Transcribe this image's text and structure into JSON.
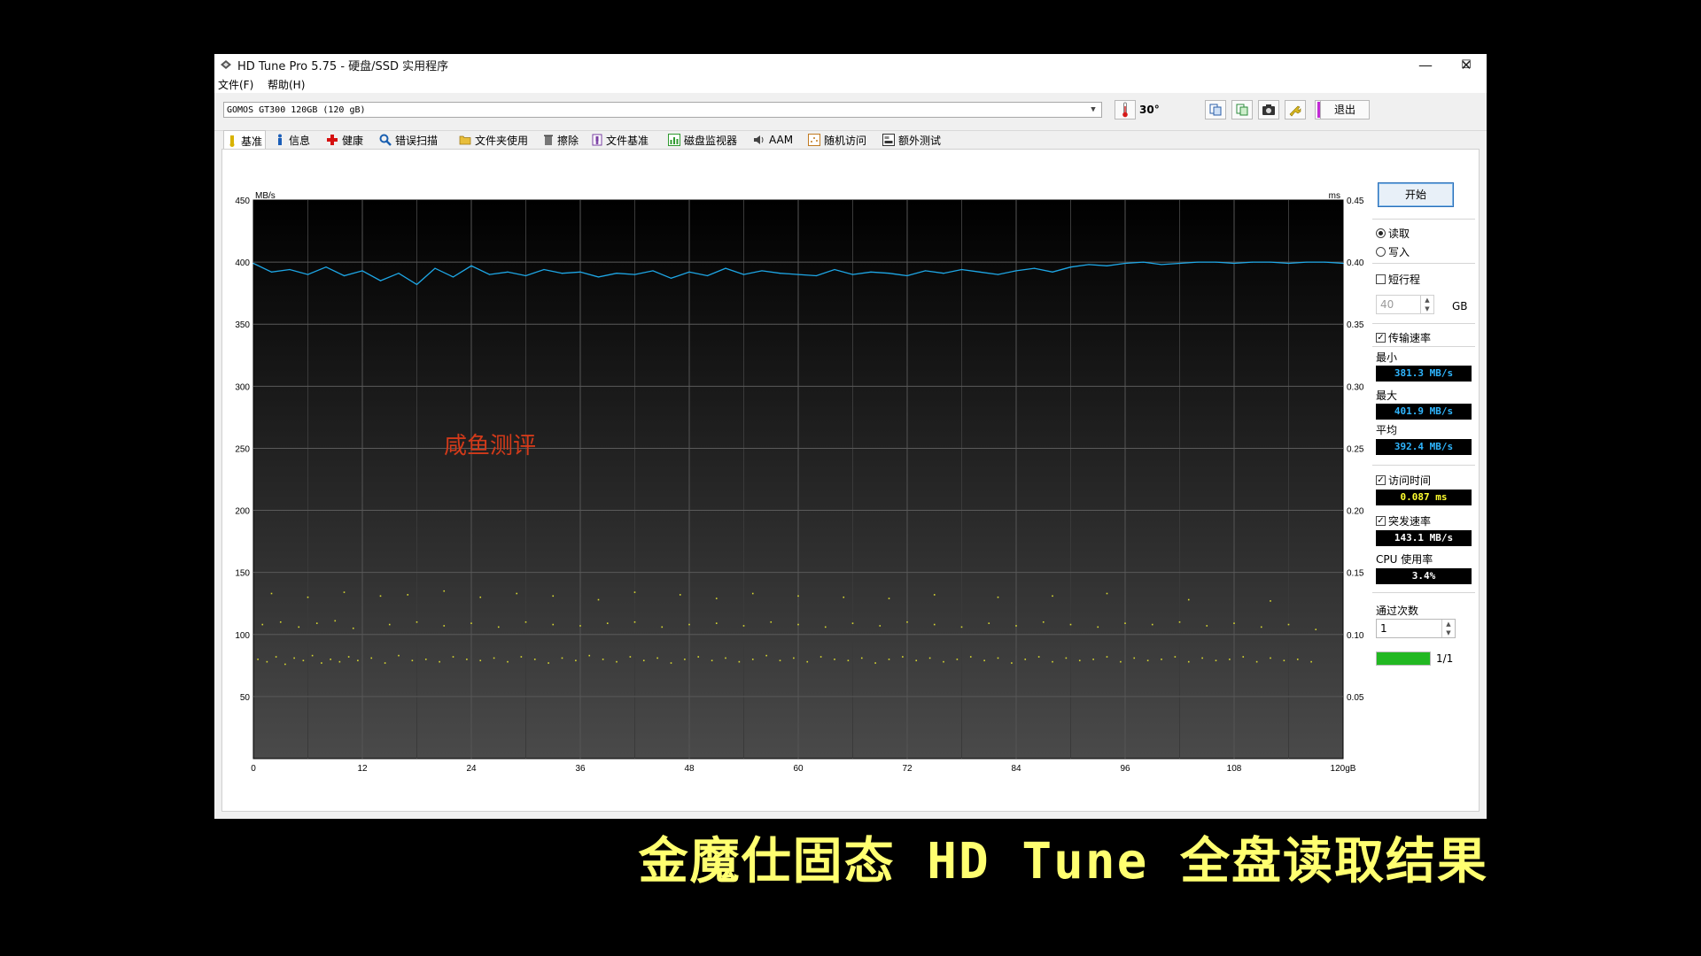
{
  "window": {
    "title": "HD Tune Pro 5.75 - 硬盘/SSD 实用程序",
    "minimize": "—",
    "maximize": "☐",
    "close": "✕"
  },
  "menu": {
    "file": "文件(F)",
    "help": "帮助(H)"
  },
  "toolbar": {
    "drive": "GOMOS GT300 120GB (120 gB)",
    "temperature": "30°",
    "exit_label": "退出"
  },
  "tabs": [
    {
      "label": "基准",
      "icon": "benchmark-icon",
      "color": "#c9a400"
    },
    {
      "label": "信息",
      "icon": "info-icon",
      "color": "#1b5eb8"
    },
    {
      "label": "健康",
      "icon": "health-icon",
      "color": "#d51010"
    },
    {
      "label": "错误扫描",
      "icon": "error-scan-icon",
      "color": "#1a5fb0"
    },
    {
      "label": "文件夹使用",
      "icon": "folder-icon",
      "color": "#d6a623"
    },
    {
      "label": "擦除",
      "icon": "erase-icon",
      "color": "#555555"
    },
    {
      "label": "文件基准",
      "icon": "file-benchmark-icon",
      "color": "#7a3fa3"
    },
    {
      "label": "磁盘监视器",
      "icon": "disk-monitor-icon",
      "color": "#2f9a2f"
    },
    {
      "label": "AAM",
      "icon": "speaker-icon",
      "color": "#444444"
    },
    {
      "label": "随机访问",
      "icon": "random-access-icon",
      "color": "#c07a20"
    },
    {
      "label": "额外测试",
      "icon": "extra-test-icon",
      "color": "#333333"
    }
  ],
  "side": {
    "start_label": "开始",
    "read_label": "读取",
    "write_label": "写入",
    "short_stroke_label": "短行程",
    "short_stroke_value": "40",
    "gb_label": "GB",
    "transfer_rate_label": "传输速率",
    "min_label": "最小",
    "min_value": "381.3 MB/s",
    "max_label": "最大",
    "max_value": "401.9 MB/s",
    "avg_label": "平均",
    "avg_value": "392.4 MB/s",
    "access_time_label": "访问时间",
    "access_time_value": "0.087 ms",
    "burst_rate_label": "突发速率",
    "burst_rate_value": "143.1 MB/s",
    "cpu_label": "CPU 使用率",
    "cpu_value": "3.4%",
    "passes_label": "通过次数",
    "passes_value": "1",
    "progress_text": "1/1",
    "progress": 1.0,
    "colors": {
      "speed": "#00b4ff",
      "access": "#ffff30",
      "progress": "#22b822"
    }
  },
  "watermark": "咸鱼测评",
  "caption": "金魔仕固态 HD Tune 全盘读取结果",
  "chart_data": {
    "type": "line",
    "title": "",
    "y_left_unit": "MB/s",
    "y_right_unit": "ms",
    "x_unit": "gB",
    "xlim": [
      0,
      120
    ],
    "ylim": [
      0,
      450
    ],
    "y2lim": [
      0,
      0.45
    ],
    "grid": true,
    "x_ticks": [
      "0",
      "12",
      "24",
      "36",
      "48",
      "60",
      "72",
      "84",
      "96",
      "108",
      "120gB"
    ],
    "y_ticks": [
      "450",
      "400",
      "350",
      "300",
      "250",
      "200",
      "150",
      "100",
      "50"
    ],
    "y2_ticks": [
      "0.45",
      "0.40",
      "0.35",
      "0.30",
      "0.25",
      "0.20",
      "0.15",
      "0.10",
      "0.05"
    ],
    "series": [
      {
        "metric": "transfer rate (MB/s)",
        "color": "#1ea7e6",
        "x": [
          0,
          2,
          4,
          6,
          8,
          10,
          12,
          14,
          16,
          18,
          20,
          22,
          24,
          26,
          28,
          30,
          32,
          34,
          36,
          38,
          40,
          42,
          44,
          46,
          48,
          50,
          52,
          54,
          56,
          58,
          60,
          62,
          64,
          66,
          68,
          70,
          72,
          74,
          76,
          78,
          80,
          82,
          84,
          86,
          88,
          90,
          92,
          94,
          96,
          98,
          100,
          102,
          104,
          106,
          108,
          110,
          112,
          114,
          116,
          118,
          120
        ],
        "values": [
          399,
          392,
          394,
          390,
          396,
          389,
          393,
          385,
          391,
          382,
          395,
          388,
          397,
          390,
          392,
          389,
          394,
          391,
          392,
          388,
          391,
          390,
          393,
          387,
          392,
          389,
          395,
          390,
          393,
          391,
          390,
          389,
          394,
          390,
          392,
          391,
          389,
          393,
          391,
          394,
          392,
          390,
          393,
          395,
          392,
          396,
          398,
          397,
          399,
          400,
          398,
          399,
          400,
          400,
          399,
          400,
          400,
          399,
          400,
          400,
          399
        ]
      },
      {
        "metric": "access time (ms)",
        "color": "#d8d830",
        "type": "scatter",
        "x": [
          0.5,
          1.5,
          2.5,
          3.5,
          4.5,
          5.5,
          6.5,
          7.5,
          8.5,
          9.5,
          10.5,
          11.5,
          13,
          14.5,
          16,
          17.5,
          19,
          20.5,
          22,
          23.5,
          25,
          26.5,
          28,
          29.5,
          31,
          32.5,
          34,
          35.5,
          37,
          38.5,
          40,
          41.5,
          43,
          44.5,
          46,
          47.5,
          49,
          50.5,
          52,
          53.5,
          55,
          56.5,
          58,
          59.5,
          61,
          62.5,
          64,
          65.5,
          67,
          68.5,
          70,
          71.5,
          73,
          74.5,
          76,
          77.5,
          79,
          80.5,
          82,
          83.5,
          85,
          86.5,
          88,
          89.5,
          91,
          92.5,
          94,
          95.5,
          97,
          98.5,
          100,
          101.5,
          103,
          104.5,
          106,
          107.5,
          109,
          110.5,
          112,
          113.5,
          115,
          116.5,
          1,
          3,
          5,
          7,
          9,
          11,
          15,
          18,
          21,
          24,
          27,
          30,
          33,
          36,
          39,
          42,
          45,
          48,
          51,
          54,
          57,
          60,
          63,
          66,
          69,
          72,
          75,
          78,
          81,
          84,
          87,
          90,
          93,
          96,
          99,
          102,
          105,
          108,
          111,
          114,
          117,
          2,
          6,
          10,
          14,
          17,
          21,
          25,
          29,
          33,
          38,
          42,
          47,
          51,
          55,
          60,
          65,
          70,
          75,
          82,
          88,
          94,
          103,
          112
        ],
        "values": [
          0.08,
          0.078,
          0.082,
          0.076,
          0.081,
          0.079,
          0.083,
          0.077,
          0.08,
          0.078,
          0.082,
          0.079,
          0.081,
          0.077,
          0.083,
          0.079,
          0.08,
          0.078,
          0.082,
          0.08,
          0.079,
          0.081,
          0.078,
          0.082,
          0.08,
          0.077,
          0.081,
          0.079,
          0.083,
          0.08,
          0.078,
          0.082,
          0.079,
          0.081,
          0.077,
          0.08,
          0.082,
          0.079,
          0.081,
          0.078,
          0.08,
          0.083,
          0.079,
          0.081,
          0.078,
          0.082,
          0.08,
          0.079,
          0.081,
          0.077,
          0.08,
          0.082,
          0.079,
          0.081,
          0.078,
          0.08,
          0.082,
          0.079,
          0.081,
          0.077,
          0.08,
          0.082,
          0.078,
          0.081,
          0.079,
          0.08,
          0.082,
          0.078,
          0.081,
          0.079,
          0.08,
          0.082,
          0.078,
          0.081,
          0.079,
          0.08,
          0.082,
          0.078,
          0.081,
          0.079,
          0.08,
          0.078,
          0.108,
          0.11,
          0.106,
          0.109,
          0.111,
          0.105,
          0.108,
          0.11,
          0.107,
          0.109,
          0.106,
          0.11,
          0.108,
          0.107,
          0.109,
          0.11,
          0.106,
          0.108,
          0.109,
          0.107,
          0.11,
          0.108,
          0.106,
          0.109,
          0.107,
          0.11,
          0.108,
          0.106,
          0.109,
          0.107,
          0.11,
          0.108,
          0.106,
          0.109,
          0.108,
          0.11,
          0.107,
          0.109,
          0.106,
          0.108,
          0.104,
          0.133,
          0.13,
          0.134,
          0.131,
          0.132,
          0.135,
          0.13,
          0.133,
          0.131,
          0.128,
          0.134,
          0.132,
          0.129,
          0.133,
          0.131,
          0.13,
          0.129,
          0.132,
          0.13,
          0.131,
          0.133,
          0.128,
          0.127
        ]
      }
    ]
  }
}
